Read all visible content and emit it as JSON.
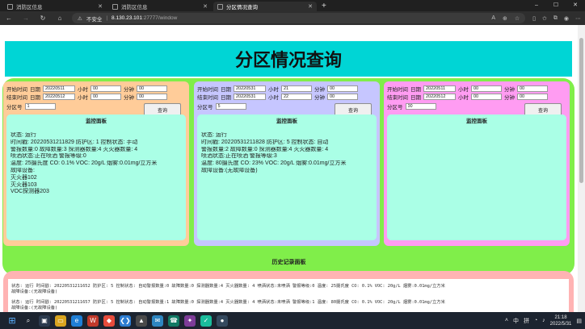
{
  "browser": {
    "tabs": [
      {
        "title": "消防区信息",
        "active": false
      },
      {
        "title": "消防区信息",
        "active": false
      },
      {
        "title": "分区情况查询",
        "active": true
      }
    ],
    "newtab_icon": "+",
    "address": {
      "insecure_label": "不安全",
      "separator": "|",
      "host": "8.130.23.101",
      "path": ":27777/window"
    },
    "window_controls": [
      "–",
      "☐",
      "✕"
    ]
  },
  "page": {
    "title": "分区情况查询",
    "labels": {
      "start_time": "开始时间",
      "end_time": "结束时间",
      "date": "日期",
      "hour": "小时",
      "minute": "分钟",
      "zone": "分区号",
      "query_button": "查询",
      "monitor_title": "监控面板"
    },
    "panels": [
      {
        "color": "#ffcc99",
        "start": {
          "date": "20220511",
          "hour": "00",
          "minute": "00"
        },
        "end": {
          "date": "20220512",
          "hour": "00",
          "minute": "00"
        },
        "zone": "1",
        "monitor": {
          "status": "状态: 运行",
          "time_line": "时间戳: 20220531211829 防护区: 1 控制状态: 手动",
          "count_line": "警报数量:0 故障数量:3 探测器数量:4 灭火器数量: 4",
          "spray_line": "喷洒状态:正在喷洒 警报等级:0",
          "env_line": "温度: 25摄氏度 CO: 0.1% VOC: 20g/L 烟雾:0.01mg/立方米",
          "fault_title": "故障设备:",
          "faults": [
            "灭火器102",
            "灭火器103",
            "VOC探测器203"
          ]
        }
      },
      {
        "color": "#c6c6ff",
        "start": {
          "date": "20220531",
          "hour": "21",
          "minute": "00"
        },
        "end": {
          "date": "20220531",
          "hour": "22",
          "minute": "00"
        },
        "zone": "5",
        "monitor": {
          "status": "状态: 运行",
          "time_line": "时间戳: 20220531211828 防护区: 5 控制状态: 自动",
          "count_line": "警报数量:2 故障数量:0 探测器数量:4 灭火器数量: 4",
          "spray_line": "喷洒状态:正在喷洒 警报等级:3",
          "env_line": "温度: 80摄氏度 CO: 23% VOC: 20g/L 烟雾:0.01mg/立方米",
          "fault_title": "故障设备:(无故障设备)",
          "faults": []
        }
      },
      {
        "color": "#ff9cf2",
        "start": {
          "date": "20220511",
          "hour": "00",
          "minute": "00"
        },
        "end": {
          "date": "20220512",
          "hour": "00",
          "minute": "00"
        },
        "zone": "00",
        "monitor": {
          "status": "",
          "time_line": "",
          "count_line": "",
          "spray_line": "",
          "env_line": "",
          "fault_title": "",
          "faults": []
        }
      }
    ],
    "history": {
      "title": "历史记录面板",
      "records": [
        {
          "line1": "状态: 运行 时间戳: 20220531211652 防护区: 5 控制状态: 自动警报数量:0 故障数量:0 探测器数量:4 灭火器数量: 4 喷洒状态:未喷洒 警报等级:0 温度: 25摄氏度 CO: 0.1% VOC: 20g/L 烟雾:0.01mg/立方米",
          "line2": "故障设备:(无故障设备)"
        },
        {
          "line1": "状态: 运行 时间戳: 20220531211657 防护区: 5 控制状态: 自动警报数量:1 故障数量:0 探测器数量:4 灭火器数量: 4 喷洒状态:未喷洒 警报等级:1 温度: 80摄氏度 CO: 0.1% VOC: 20g/L 烟雾:0.01mg/立方米",
          "line2": "故障设备:(无故障设备)"
        }
      ]
    }
  },
  "taskbar": {
    "ime": "中",
    "network": "拼",
    "time": "21:18",
    "date": "2022/5/31"
  }
}
